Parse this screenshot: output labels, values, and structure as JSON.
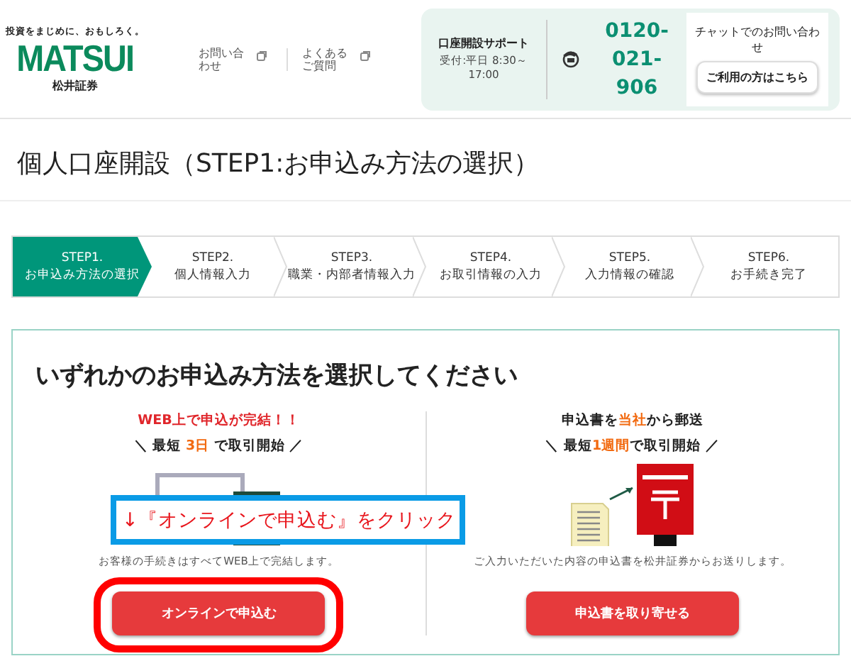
{
  "header": {
    "tagline": "投資をまじめに、おもしろく。",
    "logo": "MATSUI",
    "company": "松井証券",
    "links": [
      {
        "label": "お問い合わせ"
      },
      {
        "label": "よくあるご質問"
      }
    ],
    "support": {
      "title": "口座開設サポート",
      "hours": "受付:平日 8:30～ 17:00",
      "phone": "0120-021-906"
    },
    "chat": {
      "title": "チャットでのお問い合わせ",
      "button": "ご利用の方はこちら"
    }
  },
  "page_title": "個人口座開設（STEP1:お申込み方法の選択）",
  "steps": [
    {
      "number": "STEP1.",
      "label": "お申込み方法の選択",
      "selected": true
    },
    {
      "number": "STEP2.",
      "label": "個人情報入力",
      "selected": false
    },
    {
      "number": "STEP3.",
      "label": "職業・内部者情報入力",
      "selected": false
    },
    {
      "number": "STEP4.",
      "label": "お取引情報の入力",
      "selected": false
    },
    {
      "number": "STEP5.",
      "label": "入力情報の確認",
      "selected": false
    },
    {
      "number": "STEP6.",
      "label": "お手続き完了",
      "selected": false
    }
  ],
  "selection": {
    "heading": "いずれかのお申込み方法を選択してください",
    "options": [
      {
        "kind": "online",
        "headline": "WEB上で申込が完結！！",
        "speed": "＼ 最短 **3日** で取引開始 ／",
        "note": "お客様の手続きはすべてWEB上で完結します。",
        "button": "オンラインで申込む",
        "highlighted": true
      },
      {
        "kind": "mail",
        "headline": "申込書を**当社**から郵送",
        "speed": "＼ 最短**1週間**で取引開始 ／",
        "note": "ご入力いただいた内容の申込書を松井証券からお送りします。",
        "button": "申込書を取り寄せる",
        "highlighted": false
      }
    ]
  },
  "annotation": {
    "callout": "↓『オンラインで申込む』をクリック"
  }
}
